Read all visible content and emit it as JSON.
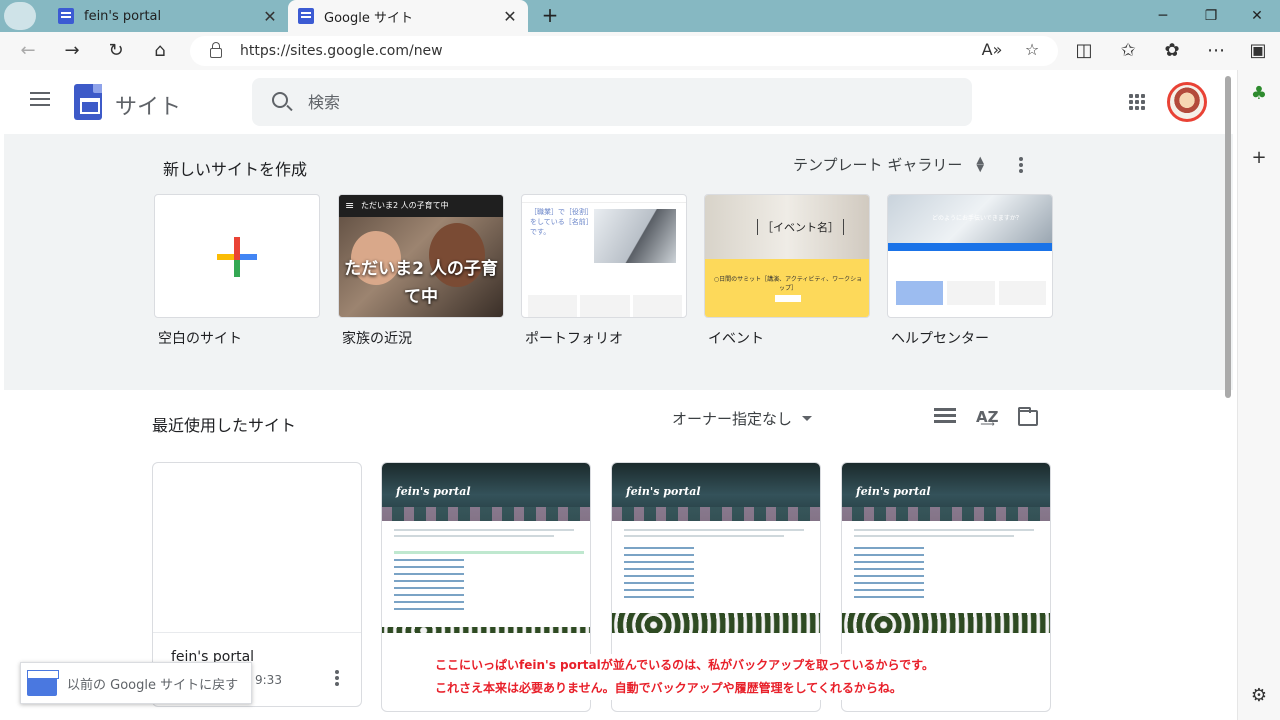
{
  "browser": {
    "tabs": [
      {
        "title": "fein's portal",
        "active": false
      },
      {
        "title": "Google サイト",
        "active": true
      }
    ],
    "url": "https://sites.google.com/new",
    "window_controls": {
      "minimize": "─",
      "restore": "❐",
      "close": "✕"
    }
  },
  "app": {
    "name": "サイト",
    "search_placeholder": "検索"
  },
  "create": {
    "title": "新しいサイトを作成",
    "gallery_label": "テンプレート ギャラリー",
    "templates": [
      {
        "label": "空白のサイト"
      },
      {
        "label": "家族の近況",
        "thumb_text": "ただいま2 人の子育て中",
        "thumb_bar": "ただいま2 人の子育て中"
      },
      {
        "label": "ポートフォリオ",
        "thumb_text": "［職業］で［役割］をしている［名前］です。"
      },
      {
        "label": "イベント",
        "thumb_title": "［イベント名］",
        "thumb_text": "○日間のサミット［講演、アクティビティ、ワークショップ］"
      },
      {
        "label": "ヘルプセンター",
        "thumb_text": "どのようにお手伝いできますか？"
      }
    ]
  },
  "recent": {
    "title": "最近使用したサイト",
    "owner_filter": "オーナー指定なし",
    "cards": [
      {
        "name": "fein's portal",
        "time": "9:33"
      },
      {
        "logo": "fein's portal"
      },
      {
        "logo": "fein's portal"
      },
      {
        "logo": "fein's portal"
      }
    ]
  },
  "toast": {
    "text": "以前の Google サイトに戻す"
  },
  "annotation": {
    "line1": "ここにいっぱいfein's portalが並んでいるのは、私がバックアップを取っているからです。",
    "line2": "これさえ本来は必要ありません。自動でバックアップや履歴管理をしてくれるからね。"
  },
  "colors": {
    "accent_blue": "#1a73e8",
    "sites_logo": "#3d5ac8",
    "annotation_red": "#e8202a",
    "section_bg": "#f1f3f4"
  }
}
